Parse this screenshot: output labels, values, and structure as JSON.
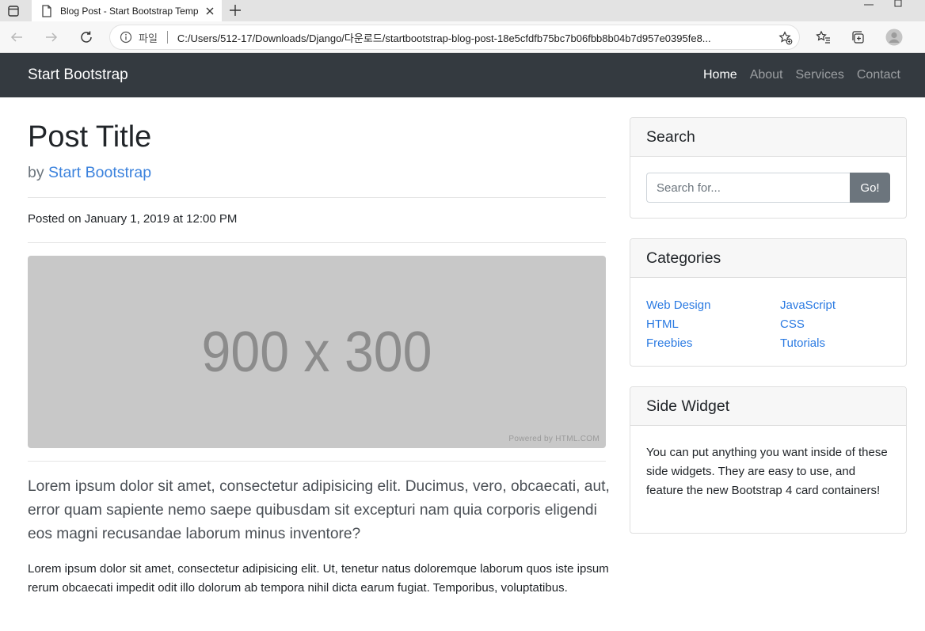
{
  "browser": {
    "tab_title": "Blog Post - Start Bootstrap Temp",
    "address_file_label": "파일",
    "address_url": "C:/Users/512-17/Downloads/Django/다운로드/startbootstrap-blog-post-18e5cfdfb75bc7b06fbb8b04b7d957e0395fe8..."
  },
  "navbar": {
    "brand": "Start Bootstrap",
    "links": [
      {
        "label": "Home",
        "active": true
      },
      {
        "label": "About",
        "active": false
      },
      {
        "label": "Services",
        "active": false
      },
      {
        "label": "Contact",
        "active": false
      }
    ]
  },
  "post": {
    "title": "Post Title",
    "by_prefix": "by",
    "author": "Start Bootstrap",
    "posted": "Posted on January 1, 2019 at 12:00 PM",
    "image_placeholder": "900 x 300",
    "image_credit": "Powered by HTML.COM",
    "lead": "Lorem ipsum dolor sit amet, consectetur adipisicing elit. Ducimus, vero, obcaecati, aut, error quam sapiente nemo saepe quibusdam sit excepturi nam quia corporis eligendi eos magni recusandae laborum minus inventore?",
    "paragraph": "Lorem ipsum dolor sit amet, consectetur adipisicing elit. Ut, tenetur natus doloremque laborum quos iste ipsum rerum obcaecati impedit odit illo dolorum ab tempora nihil dicta earum fugiat. Temporibus, voluptatibus."
  },
  "sidebar": {
    "search": {
      "title": "Search",
      "placeholder": "Search for...",
      "button": "Go!"
    },
    "categories": {
      "title": "Categories",
      "items": [
        "Web Design",
        "JavaScript",
        "HTML",
        "CSS",
        "Freebies",
        "Tutorials"
      ]
    },
    "widget": {
      "title": "Side Widget",
      "text": "You can put anything you want inside of these side widgets. They are easy to use, and feature the new Bootstrap 4 card containers!"
    }
  },
  "colors": {
    "navbar_bg": "#343a40",
    "link": "#2a7ae2",
    "button_secondary": "#6c757d"
  }
}
